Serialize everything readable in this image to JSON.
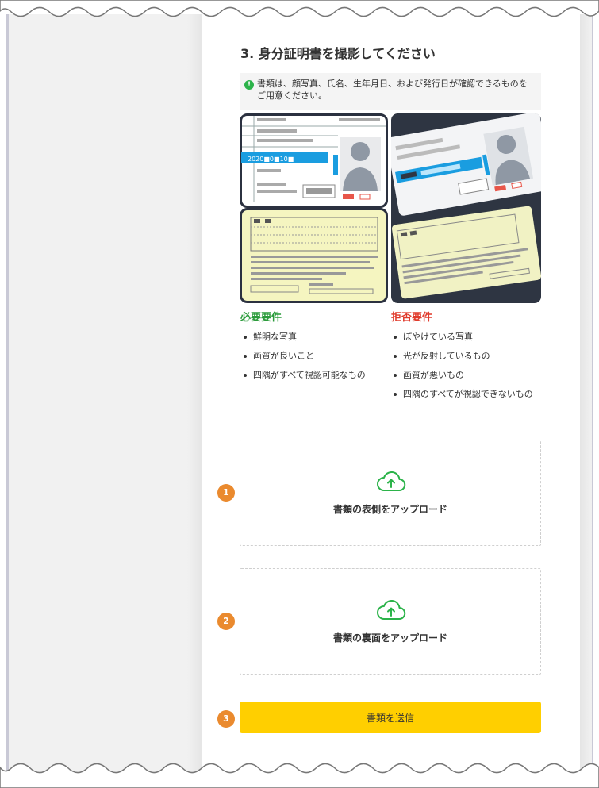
{
  "step": {
    "title": "3. 身分証明書を撮影してください"
  },
  "notice": {
    "icon": "info-icon",
    "text": "書類は、顔写真、氏名、生年月日、および発行日が確認できるものをご用意ください。"
  },
  "sample_card": {
    "date_text": "2020■0■10■"
  },
  "requirements": {
    "good": {
      "title": "必要要件",
      "items": [
        "鮮明な写真",
        "画質が良いこと",
        "四隅がすべて視認可能なもの"
      ]
    },
    "bad": {
      "title": "拒否要件",
      "items": [
        "ぼやけている写真",
        "光が反射しているもの",
        "画質が悪いもの",
        "四隅のすべてが視認できないもの"
      ]
    }
  },
  "uploads": {
    "front": {
      "label": "書類の表側をアップロード",
      "marker": "1",
      "icon": "cloud-upload-icon"
    },
    "back": {
      "label": "書類の裏面をアップロード",
      "marker": "2",
      "icon": "cloud-upload-icon"
    }
  },
  "submit": {
    "label": "書類を送信",
    "marker": "3"
  },
  "colors": {
    "accent_yellow": "#ffcf00",
    "marker_orange": "#ea8a2e",
    "good_green": "#2b9b3b",
    "bad_red": "#e03a2b",
    "icon_green": "#2cb34a"
  }
}
